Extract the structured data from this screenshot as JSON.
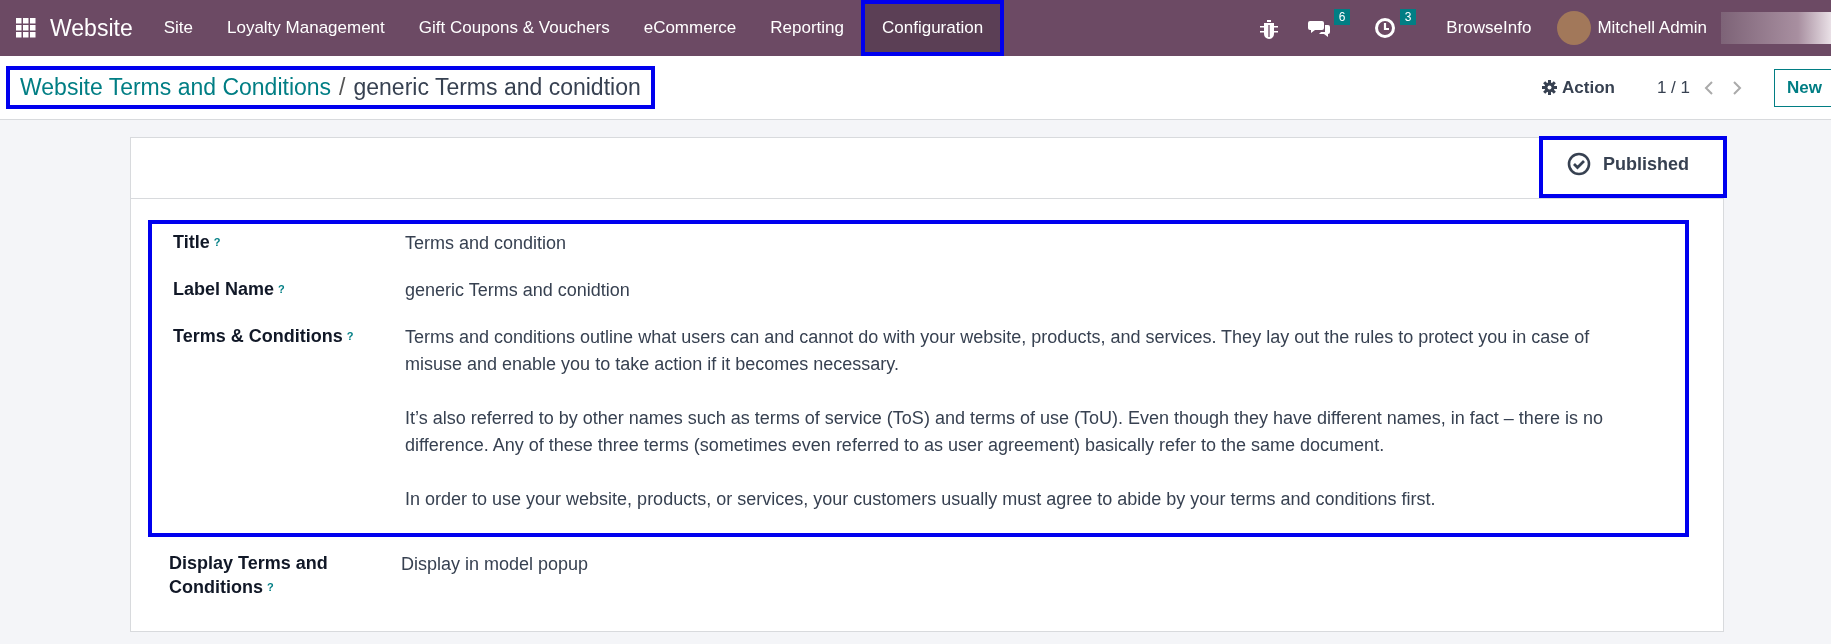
{
  "navbar": {
    "app_title": "Website",
    "menu": [
      {
        "label": "Site",
        "selected": false,
        "highlighted": false
      },
      {
        "label": "Loyalty Management",
        "selected": false,
        "highlighted": false
      },
      {
        "label": "Gift Coupons & Vouchers",
        "selected": false,
        "highlighted": false
      },
      {
        "label": "eCommerce",
        "selected": false,
        "highlighted": false
      },
      {
        "label": "Reporting",
        "selected": false,
        "highlighted": false
      },
      {
        "label": "Configuration",
        "selected": true,
        "highlighted": true
      }
    ],
    "systray": [
      {
        "kind": "bug"
      },
      {
        "kind": "chat",
        "badge": "6"
      },
      {
        "kind": "activity",
        "badge": "3"
      }
    ],
    "company": "BrowseInfo",
    "user": "Mitchell Admin"
  },
  "control_panel": {
    "breadcrumb": {
      "parent": "Website Terms and Conditions",
      "separator": "/",
      "current": "generic Terms and conidtion",
      "highlighted": true
    },
    "action": "Action",
    "pager": "1 / 1",
    "new_button": "New"
  },
  "form": {
    "publish": {
      "label": "Published",
      "published": true,
      "highlighted": true
    },
    "fields_highlighted": true,
    "fields": [
      {
        "label": "Title",
        "help": "?",
        "value": [
          "Terms and condition"
        ],
        "outside": false
      },
      {
        "label": "Label Name",
        "help": "?",
        "value": [
          "generic Terms and conidtion"
        ],
        "outside": false
      },
      {
        "label": "Terms & Conditions",
        "help": "?",
        "value": [
          "Terms and conditions outline what users can and cannot do with your website, products, and services. They lay out the rules to protect you in case of misuse and enable you to take action if it becomes necessary.",
          "It’s also referred to by other names such as terms of service (ToS) and terms of use (ToU). Even though they have different names, in fact – there is no difference. Any of these three terms (sometimes even referred to as user agreement) basically refer to the same document.",
          "In order to use your website, products, or services, your customers usually must agree to abide by your terms and conditions first."
        ],
        "outside": false
      },
      {
        "label": "Display Terms and Conditions",
        "help": "?",
        "value": [
          "Display in model popup"
        ],
        "outside": true
      }
    ]
  }
}
